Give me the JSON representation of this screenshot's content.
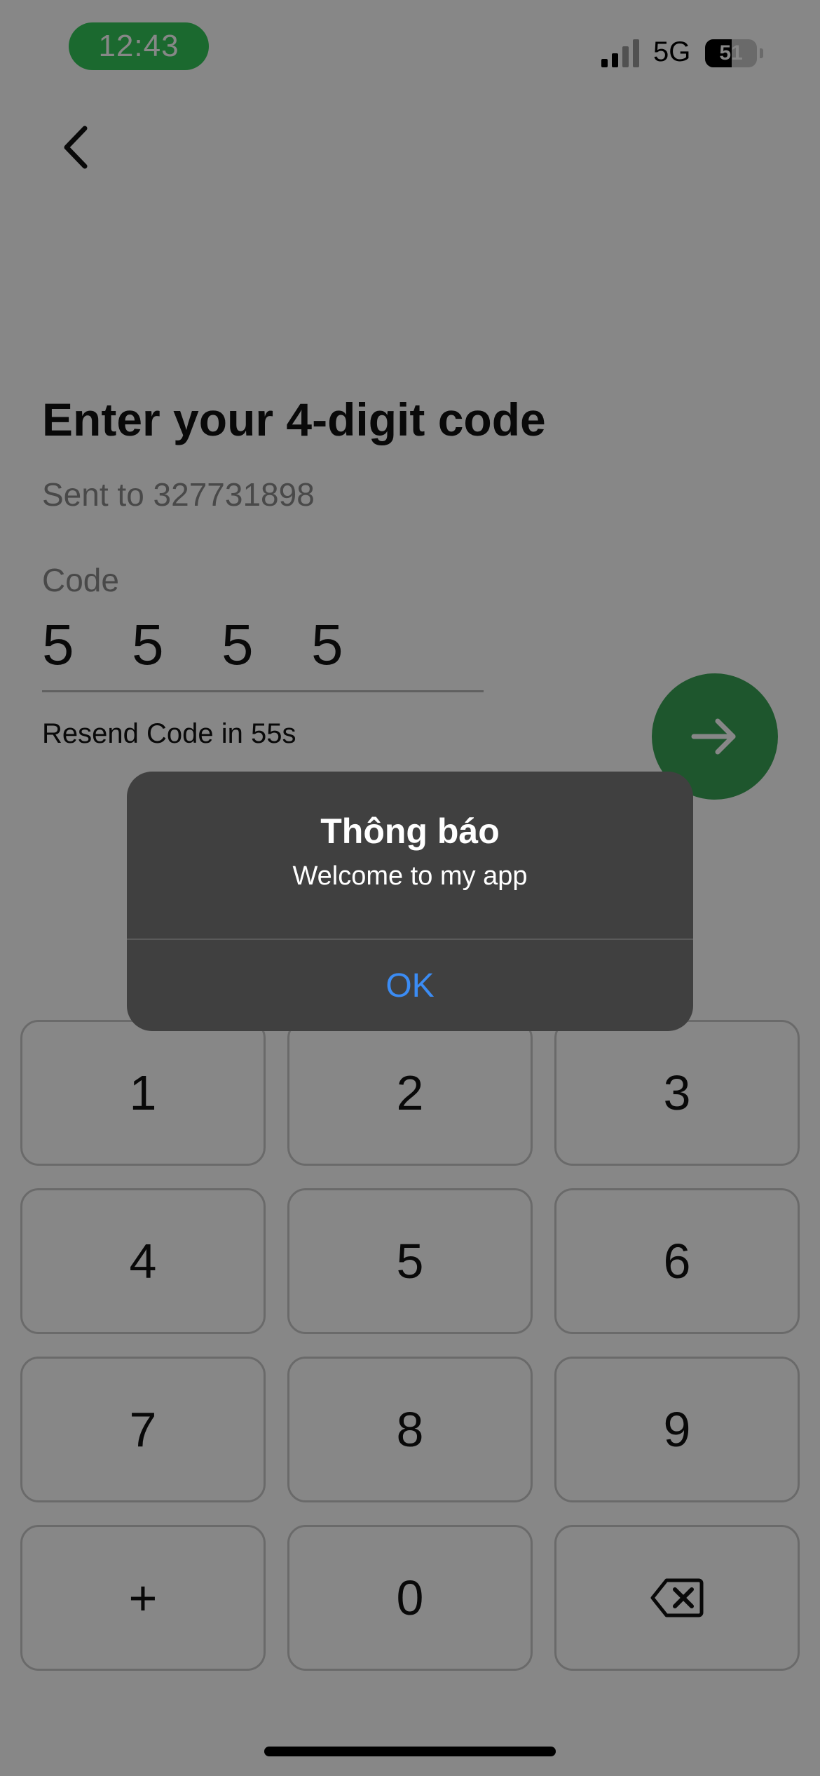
{
  "status_bar": {
    "time": "12:43",
    "network": "5G",
    "battery_level": "51",
    "battery_fraction": 0.51,
    "time_pill_color": "#34c759"
  },
  "back_icon": "chevron-left-icon",
  "title": "Enter your 4-digit code",
  "subtitle": "Sent to 327731898",
  "code": {
    "label": "Code",
    "digits": [
      "5",
      "5",
      "5",
      "5"
    ]
  },
  "resend_text": "Resend Code in 55s",
  "next_button": {
    "icon": "arrow-right-icon",
    "color": "#3aa255"
  },
  "keypad": {
    "keys": [
      "1",
      "2",
      "3",
      "4",
      "5",
      "6",
      "7",
      "8",
      "9",
      "+",
      "0"
    ],
    "backspace_icon": "backspace-icon"
  },
  "alert": {
    "title": "Thông báo",
    "message": "Welcome to my app",
    "ok_label": "OK",
    "ok_color": "#3b8cf4"
  }
}
